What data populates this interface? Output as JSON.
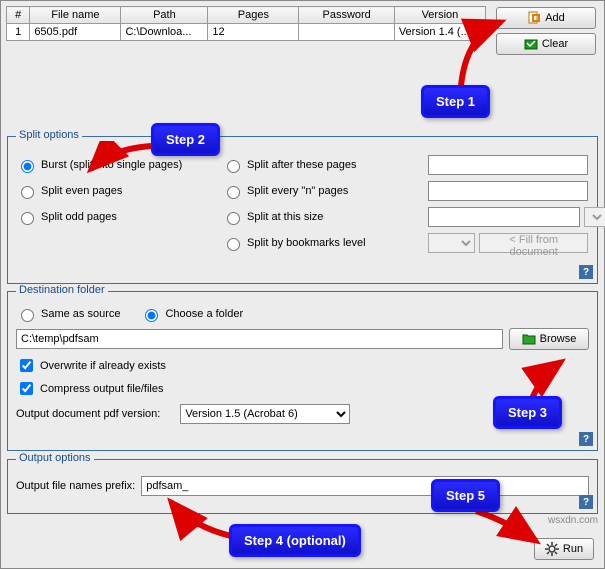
{
  "table": {
    "headers": {
      "num": "#",
      "name": "File name",
      "path": "Path",
      "pages": "Pages",
      "password": "Password",
      "version": "Version"
    },
    "rows": [
      {
        "num": "1",
        "name": "6505.pdf",
        "path": "C:\\Downloa...",
        "pages": "12",
        "password": "",
        "version": "Version 1.4 (..."
      }
    ]
  },
  "buttons": {
    "add": "Add",
    "clear": "Clear",
    "browse": "Browse",
    "fill": "< Fill from document",
    "run": "Run",
    "help": "?"
  },
  "split": {
    "legend": "Split options",
    "burst": "Burst (split into single pages)",
    "even": "Split even pages",
    "odd": "Split odd pages",
    "after": "Split after these pages",
    "everyn": "Split every \"n\" pages",
    "atsize": "Split at this size",
    "bybm": "Split by bookmarks level"
  },
  "dest": {
    "legend": "Destination folder",
    "same": "Same as source",
    "choose": "Choose a folder",
    "path": "C:\\temp\\pdfsam",
    "overwrite": "Overwrite if already exists",
    "compress": "Compress output file/files",
    "outver_label": "Output document pdf version:",
    "outver_value": "Version 1.5 (Acrobat 6)"
  },
  "output": {
    "legend": "Output options",
    "prefix_label": "Output file names prefix:",
    "prefix_value": "pdfsam_"
  },
  "callouts": {
    "s1": "Step 1",
    "s2": "Step 2",
    "s3": "Step 3",
    "s4": "Step 4 (optional)",
    "s5": "Step 5"
  },
  "watermark": "wsxdn.com"
}
